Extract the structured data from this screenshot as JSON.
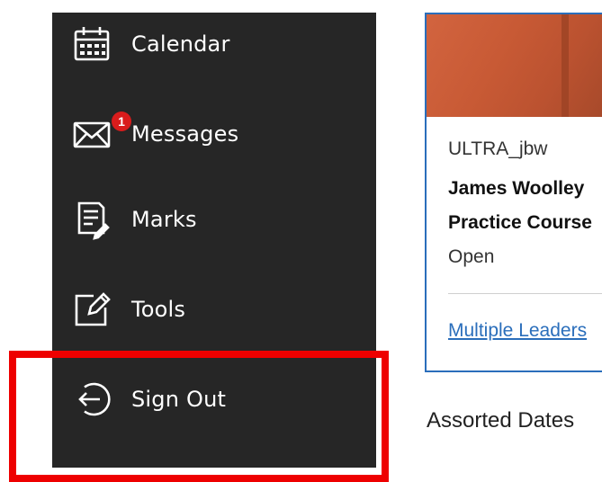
{
  "nav": {
    "items": [
      {
        "label": "Calendar",
        "icon": "calendar-icon"
      },
      {
        "label": "Messages",
        "icon": "envelope-icon",
        "badge": "1"
      },
      {
        "label": "Marks",
        "icon": "marks-document-icon"
      },
      {
        "label": "Tools",
        "icon": "edit-square-icon"
      },
      {
        "label": "Sign Out",
        "icon": "sign-out-icon"
      }
    ]
  },
  "course_card": {
    "course_id": "ULTRA_jbw",
    "instructor": "James Woolley",
    "course_name": "Practice Course",
    "status": "Open",
    "link": "Multiple Leaders"
  },
  "section_heading": "Assorted Dates",
  "colors": {
    "nav_background": "#262626",
    "highlight_border": "#ee0000",
    "badge": "#d91c1c",
    "link": "#2a6ebb"
  }
}
